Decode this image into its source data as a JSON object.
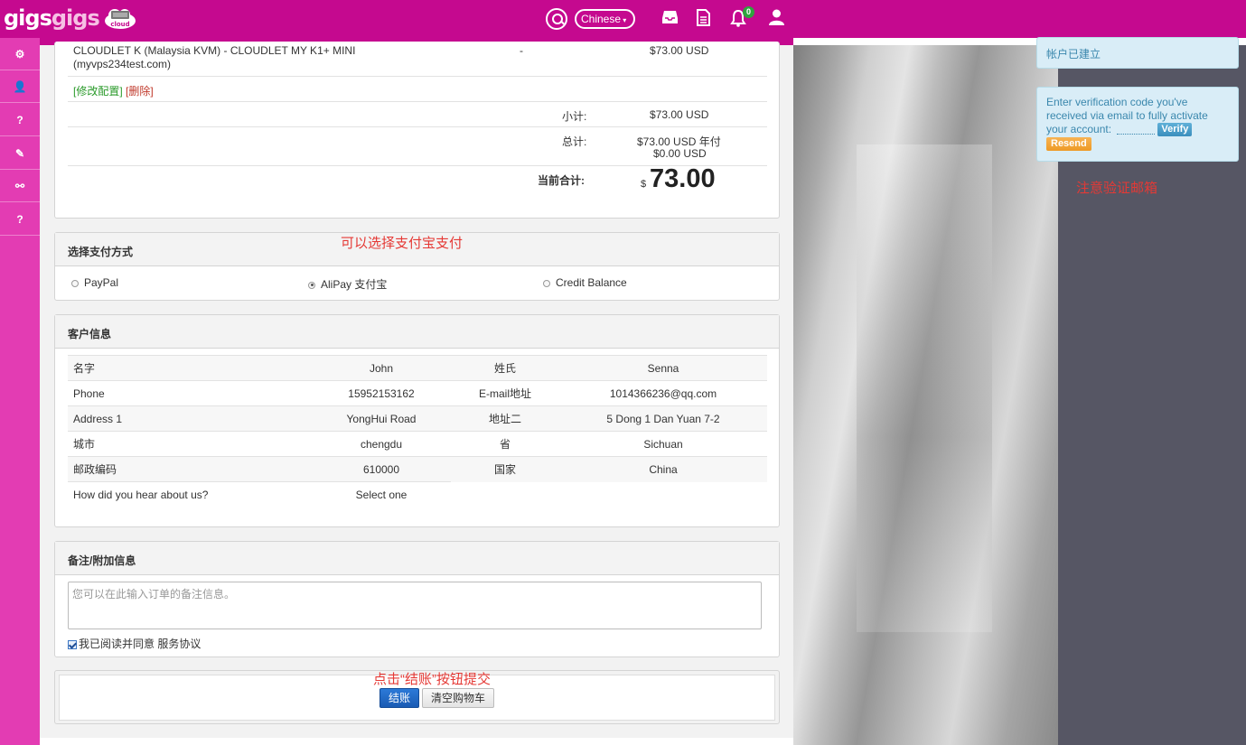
{
  "header": {
    "logo_word1": "gigs",
    "logo_word2": "gigs",
    "logo_badge": "cloud",
    "language": "Chinese",
    "notification_count": "0"
  },
  "cart": {
    "product_line1": "CLOUDLET K (Malaysia KVM) - CLOUDLET MY K1+ MINI",
    "product_line2": "(myvps234test.com)",
    "product_dash": "-",
    "product_price": "$73.00 USD",
    "edit_config": "[修改配置]",
    "remove": "[删除]",
    "subtotal_label": "小计:",
    "subtotal_value": "$73.00 USD",
    "total_label": "总计:",
    "total_line1": "$73.00 USD 年付",
    "total_line2": "$0.00 USD",
    "current_total_label": "当前合计:",
    "currency_symbol": "$",
    "current_total_value": "73.00"
  },
  "payment": {
    "title": "选择支付方式",
    "options": [
      "PayPal",
      "AliPay 支付宝",
      "Credit Balance"
    ],
    "selected": "AliPay 支付宝"
  },
  "customer": {
    "title": "客户信息",
    "rows": [
      [
        "名字",
        "John",
        "姓氏",
        "Senna"
      ],
      [
        "Phone",
        "15952153162",
        "E-mail地址",
        "1014366236@qq.com"
      ],
      [
        "Address 1",
        "YongHui Road",
        "地址二",
        "5 Dong 1 Dan Yuan 7-2"
      ],
      [
        "城市",
        "chengdu",
        "省",
        "Sichuan"
      ],
      [
        "邮政编码",
        "610000",
        "国家",
        "China"
      ]
    ],
    "hear_label": "How did you hear about us?",
    "hear_value": "Select one"
  },
  "notes": {
    "title": "备注/附加信息",
    "placeholder": "您可以在此输入订单的备注信息。",
    "agree_text": "我已阅读并同意",
    "tos_link": "服务协议"
  },
  "actions": {
    "checkout": "结账",
    "empty_cart": "清空购物车"
  },
  "notifications": {
    "account_created": "帐户已建立",
    "verify_text": "Enter verification code you've received via email to fully activate your account:",
    "verify_button": "Verify",
    "resend_button": "Resend"
  },
  "annotations": {
    "alipay_hint": "可以选择支付宝支付",
    "email_hint": "注意验证邮箱",
    "checkout_hint": "点击“结账”按钮提交"
  },
  "colors": {
    "brand": "#c5098f",
    "sidebar": "#e33cb3",
    "primary_button": "#1a5bb3",
    "annotation": "#e53935"
  }
}
